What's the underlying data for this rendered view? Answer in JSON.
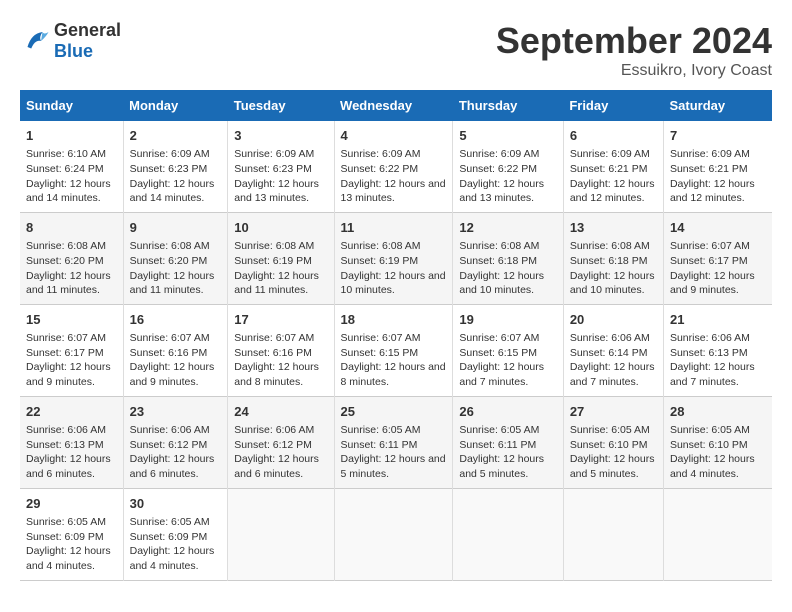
{
  "logo": {
    "line1": "General",
    "line2": "Blue"
  },
  "title": "September 2024",
  "location": "Essuikro, Ivory Coast",
  "days_of_week": [
    "Sunday",
    "Monday",
    "Tuesday",
    "Wednesday",
    "Thursday",
    "Friday",
    "Saturday"
  ],
  "weeks": [
    [
      {
        "day": "1",
        "sunrise": "Sunrise: 6:10 AM",
        "sunset": "Sunset: 6:24 PM",
        "daylight": "Daylight: 12 hours and 14 minutes."
      },
      {
        "day": "2",
        "sunrise": "Sunrise: 6:09 AM",
        "sunset": "Sunset: 6:23 PM",
        "daylight": "Daylight: 12 hours and 14 minutes."
      },
      {
        "day": "3",
        "sunrise": "Sunrise: 6:09 AM",
        "sunset": "Sunset: 6:23 PM",
        "daylight": "Daylight: 12 hours and 13 minutes."
      },
      {
        "day": "4",
        "sunrise": "Sunrise: 6:09 AM",
        "sunset": "Sunset: 6:22 PM",
        "daylight": "Daylight: 12 hours and 13 minutes."
      },
      {
        "day": "5",
        "sunrise": "Sunrise: 6:09 AM",
        "sunset": "Sunset: 6:22 PM",
        "daylight": "Daylight: 12 hours and 13 minutes."
      },
      {
        "day": "6",
        "sunrise": "Sunrise: 6:09 AM",
        "sunset": "Sunset: 6:21 PM",
        "daylight": "Daylight: 12 hours and 12 minutes."
      },
      {
        "day": "7",
        "sunrise": "Sunrise: 6:09 AM",
        "sunset": "Sunset: 6:21 PM",
        "daylight": "Daylight: 12 hours and 12 minutes."
      }
    ],
    [
      {
        "day": "8",
        "sunrise": "Sunrise: 6:08 AM",
        "sunset": "Sunset: 6:20 PM",
        "daylight": "Daylight: 12 hours and 11 minutes."
      },
      {
        "day": "9",
        "sunrise": "Sunrise: 6:08 AM",
        "sunset": "Sunset: 6:20 PM",
        "daylight": "Daylight: 12 hours and 11 minutes."
      },
      {
        "day": "10",
        "sunrise": "Sunrise: 6:08 AM",
        "sunset": "Sunset: 6:19 PM",
        "daylight": "Daylight: 12 hours and 11 minutes."
      },
      {
        "day": "11",
        "sunrise": "Sunrise: 6:08 AM",
        "sunset": "Sunset: 6:19 PM",
        "daylight": "Daylight: 12 hours and 10 minutes."
      },
      {
        "day": "12",
        "sunrise": "Sunrise: 6:08 AM",
        "sunset": "Sunset: 6:18 PM",
        "daylight": "Daylight: 12 hours and 10 minutes."
      },
      {
        "day": "13",
        "sunrise": "Sunrise: 6:08 AM",
        "sunset": "Sunset: 6:18 PM",
        "daylight": "Daylight: 12 hours and 10 minutes."
      },
      {
        "day": "14",
        "sunrise": "Sunrise: 6:07 AM",
        "sunset": "Sunset: 6:17 PM",
        "daylight": "Daylight: 12 hours and 9 minutes."
      }
    ],
    [
      {
        "day": "15",
        "sunrise": "Sunrise: 6:07 AM",
        "sunset": "Sunset: 6:17 PM",
        "daylight": "Daylight: 12 hours and 9 minutes."
      },
      {
        "day": "16",
        "sunrise": "Sunrise: 6:07 AM",
        "sunset": "Sunset: 6:16 PM",
        "daylight": "Daylight: 12 hours and 9 minutes."
      },
      {
        "day": "17",
        "sunrise": "Sunrise: 6:07 AM",
        "sunset": "Sunset: 6:16 PM",
        "daylight": "Daylight: 12 hours and 8 minutes."
      },
      {
        "day": "18",
        "sunrise": "Sunrise: 6:07 AM",
        "sunset": "Sunset: 6:15 PM",
        "daylight": "Daylight: 12 hours and 8 minutes."
      },
      {
        "day": "19",
        "sunrise": "Sunrise: 6:07 AM",
        "sunset": "Sunset: 6:15 PM",
        "daylight": "Daylight: 12 hours and 7 minutes."
      },
      {
        "day": "20",
        "sunrise": "Sunrise: 6:06 AM",
        "sunset": "Sunset: 6:14 PM",
        "daylight": "Daylight: 12 hours and 7 minutes."
      },
      {
        "day": "21",
        "sunrise": "Sunrise: 6:06 AM",
        "sunset": "Sunset: 6:13 PM",
        "daylight": "Daylight: 12 hours and 7 minutes."
      }
    ],
    [
      {
        "day": "22",
        "sunrise": "Sunrise: 6:06 AM",
        "sunset": "Sunset: 6:13 PM",
        "daylight": "Daylight: 12 hours and 6 minutes."
      },
      {
        "day": "23",
        "sunrise": "Sunrise: 6:06 AM",
        "sunset": "Sunset: 6:12 PM",
        "daylight": "Daylight: 12 hours and 6 minutes."
      },
      {
        "day": "24",
        "sunrise": "Sunrise: 6:06 AM",
        "sunset": "Sunset: 6:12 PM",
        "daylight": "Daylight: 12 hours and 6 minutes."
      },
      {
        "day": "25",
        "sunrise": "Sunrise: 6:05 AM",
        "sunset": "Sunset: 6:11 PM",
        "daylight": "Daylight: 12 hours and 5 minutes."
      },
      {
        "day": "26",
        "sunrise": "Sunrise: 6:05 AM",
        "sunset": "Sunset: 6:11 PM",
        "daylight": "Daylight: 12 hours and 5 minutes."
      },
      {
        "day": "27",
        "sunrise": "Sunrise: 6:05 AM",
        "sunset": "Sunset: 6:10 PM",
        "daylight": "Daylight: 12 hours and 5 minutes."
      },
      {
        "day": "28",
        "sunrise": "Sunrise: 6:05 AM",
        "sunset": "Sunset: 6:10 PM",
        "daylight": "Daylight: 12 hours and 4 minutes."
      }
    ],
    [
      {
        "day": "29",
        "sunrise": "Sunrise: 6:05 AM",
        "sunset": "Sunset: 6:09 PM",
        "daylight": "Daylight: 12 hours and 4 minutes."
      },
      {
        "day": "30",
        "sunrise": "Sunrise: 6:05 AM",
        "sunset": "Sunset: 6:09 PM",
        "daylight": "Daylight: 12 hours and 4 minutes."
      },
      null,
      null,
      null,
      null,
      null
    ]
  ]
}
